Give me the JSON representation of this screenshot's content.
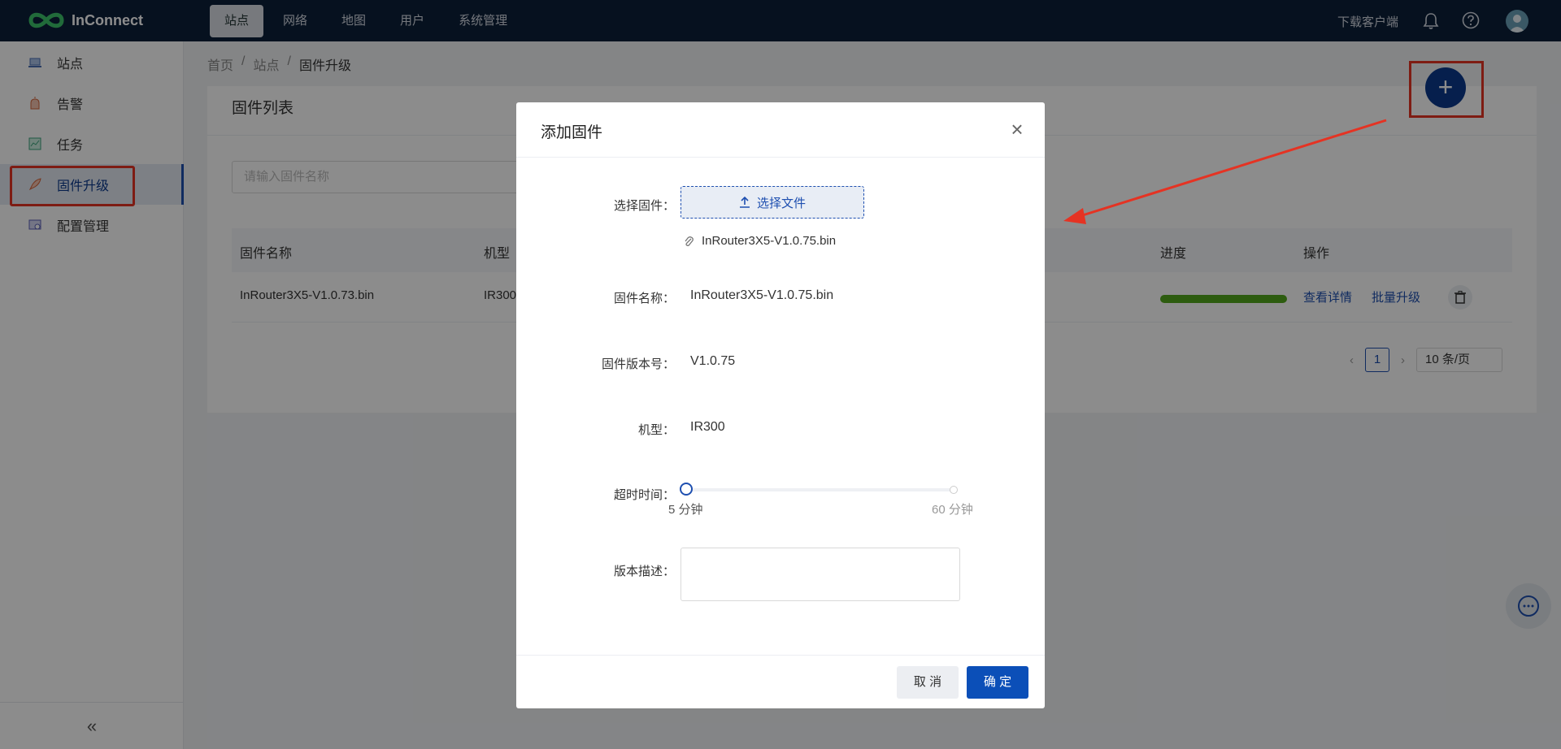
{
  "app": {
    "logo_text": "InConnect"
  },
  "topnav": {
    "items": [
      {
        "label": "站点"
      },
      {
        "label": "网络"
      },
      {
        "label": "地图"
      },
      {
        "label": "用户"
      },
      {
        "label": "系统管理"
      }
    ],
    "download": "下载客户端"
  },
  "sidebar": {
    "items": [
      {
        "label": "站点"
      },
      {
        "label": "告警"
      },
      {
        "label": "任务"
      },
      {
        "label": "固件升级"
      },
      {
        "label": "配置管理"
      }
    ],
    "collapse": "«"
  },
  "breadcrumb": [
    "首页",
    "站点",
    "固件升级"
  ],
  "card": {
    "title": "固件列表",
    "search_placeholder": "请输入固件名称",
    "columns": [
      "固件名称",
      "机型",
      "进度",
      "操作"
    ],
    "rows": [
      {
        "name": "InRouter3X5-V1.0.73.bin",
        "model": "IR300",
        "progress": 1.0,
        "action_detail": "查看详情",
        "action_batch": "批量升级"
      }
    ],
    "pager": {
      "current": "1",
      "page_size": "10 条/页"
    }
  },
  "fab": {
    "label": "+"
  },
  "modal": {
    "title": "添加固件",
    "close": "×",
    "fields": {
      "firmware_label": "选择固件：",
      "upload_label": "选择文件",
      "file_name": "InRouter3X5-V1.0.75.bin",
      "name_label": "固件名称：",
      "name_value": "InRouter3X5-V1.0.75.bin",
      "version_label": "固件版本号：",
      "version_value": "V1.0.75",
      "model_label": "机型：",
      "model_value": "IR300",
      "timeout_label": "超时时间：",
      "timeout_min": "5 分钟",
      "timeout_max": "60 分钟",
      "desc_label": "版本描述："
    },
    "cancel": "取 消",
    "ok": "确 定"
  },
  "colors": {
    "topbar": "#0b1f3a",
    "primary": "#1e4fb0",
    "progress": "#52a81d",
    "highlight": "#e53323"
  }
}
